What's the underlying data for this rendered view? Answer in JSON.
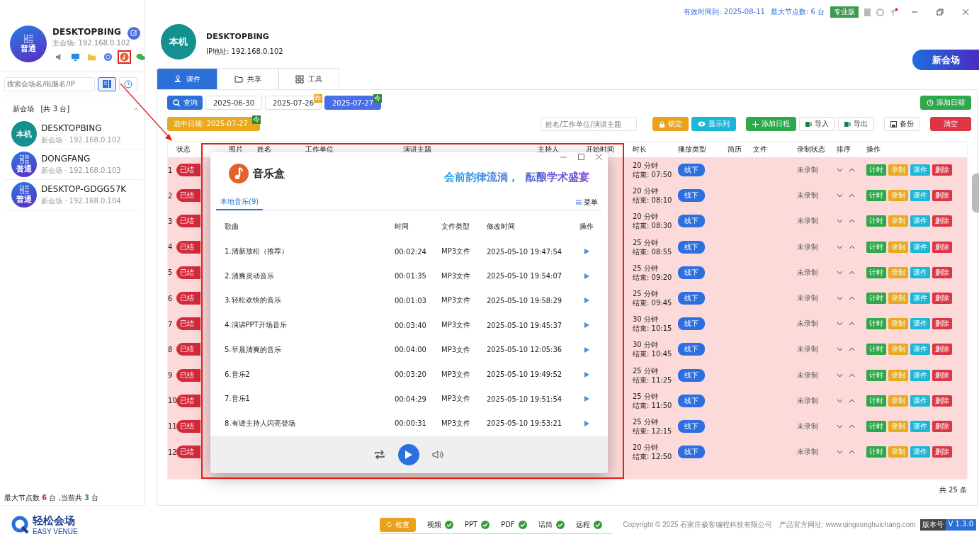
{
  "sidebar": {
    "profile": {
      "avatar_label": "普通",
      "name": "DESKTOPBING",
      "subtitle": "主会场: 192.168.0.102",
      "tools": [
        {
          "kind": "speaker",
          "highlighted": false
        },
        {
          "kind": "monitor",
          "highlighted": false
        },
        {
          "kind": "folder",
          "highlighted": false
        },
        {
          "kind": "globe",
          "highlighted": false
        },
        {
          "kind": "music",
          "highlighted": true
        },
        {
          "kind": "chat",
          "highlighted": false
        }
      ]
    },
    "search": {
      "placeholder": "搜索会场名/电脑名/IP"
    },
    "view_toggles": [
      {
        "kind": "list",
        "selected": true
      },
      {
        "kind": "history",
        "selected": false
      }
    ],
    "group": {
      "title": "新会场",
      "count": "[共 3 台]",
      "expanded": true
    },
    "venues": [
      {
        "kind": "local",
        "avatar_label": "本机",
        "name": "DESKTOPBING",
        "detail": "新会场 · 192.168.0.102"
      },
      {
        "kind": "normal",
        "avatar_label": "普通",
        "name": "DONGFANG",
        "detail": "新会场 · 192.168.0.103"
      },
      {
        "kind": "normal",
        "avatar_label": "普通",
        "name": "DESKTOP-GDGG57K",
        "detail": "新会场 · 192.168.0.104"
      }
    ],
    "footer": {
      "prefix": "最大节点数",
      "max": "6",
      "middle": "台 ,当前共",
      "count": "3",
      "suffix": "台"
    },
    "logo": {
      "name": "轻松会场",
      "tagline": "EASY VENUE"
    }
  },
  "top_bar": {
    "expiry": "有效时间到: 2025-08-11",
    "max_nodes": "最大节点数: 6 台",
    "edition": "专业版",
    "has_update": true
  },
  "header": {
    "avatar_label": "本机",
    "name": "DESKTOPBING",
    "ip": "IP地址: 192.168.0.102",
    "new_button": "新会场"
  },
  "tabs": [
    {
      "kind": "courseware",
      "label": "课件",
      "selected": true
    },
    {
      "kind": "share",
      "label": "共享",
      "selected": false
    },
    {
      "kind": "tools",
      "label": "工具",
      "selected": false
    }
  ],
  "dates": {
    "query": "查询",
    "chips": [
      {
        "date": "2025-06-30",
        "selected": false
      },
      {
        "date": "2025-07-26",
        "badge": "昨",
        "selected": false
      },
      {
        "date": "2025-07-27",
        "badge": "今",
        "selected": true
      }
    ],
    "add_date": "添加日期"
  },
  "toolbar": {
    "selected_date": "选中日期:  2025-07-27",
    "selected_badge": "今",
    "search_placeholder": "姓名/工作单位/演讲主题",
    "buttons": [
      {
        "kind": "lock",
        "label": "锁定"
      },
      {
        "kind": "columns",
        "label": "显示列"
      },
      {
        "kind": "add",
        "label": "添加日程"
      },
      {
        "kind": "import",
        "label": "导入"
      },
      {
        "kind": "export",
        "label": "导出"
      },
      {
        "kind": "backup",
        "label": "备份"
      },
      {
        "kind": "clear",
        "label": "清空"
      }
    ]
  },
  "table": {
    "columns": [
      "状态",
      "照片",
      "姓名",
      "工作单位",
      "演讲主题",
      "主持人",
      "开始时间",
      "时长",
      "播放类型",
      "简历",
      "文件",
      "录制状态",
      "排序",
      "操作"
    ],
    "rows": [
      {
        "index": "1",
        "status": "已结",
        "duration": "20 分钟",
        "end": "结束: 07:50",
        "play_type": "线下",
        "record_status": "未录制",
        "actions": [
          "计时",
          "录制",
          "课件",
          "删除"
        ]
      },
      {
        "index": "2",
        "status": "已结",
        "duration": "20 分钟",
        "end": "结束: 08:10",
        "play_type": "线下",
        "record_status": "未录制",
        "actions": [
          "计时",
          "录制",
          "课件",
          "删除"
        ]
      },
      {
        "index": "3",
        "status": "已结",
        "duration": "20 分钟",
        "end": "结束: 08:30",
        "play_type": "线下",
        "record_status": "未录制",
        "actions": [
          "计时",
          "录制",
          "课件",
          "删除"
        ]
      },
      {
        "index": "4",
        "status": "已结",
        "duration": "25 分钟",
        "end": "结束: 08:55",
        "play_type": "线下",
        "record_status": "未录制",
        "actions": [
          "计时",
          "录制",
          "课件",
          "删除"
        ]
      },
      {
        "index": "5",
        "status": "已结",
        "duration": "25 分钟",
        "end": "结束: 09:20",
        "play_type": "线下",
        "record_status": "未录制",
        "actions": [
          "计时",
          "录制",
          "课件",
          "删除"
        ]
      },
      {
        "index": "6",
        "status": "已结",
        "duration": "25 分钟",
        "end": "结束: 09:45",
        "play_type": "线下",
        "record_status": "未录制",
        "actions": [
          "计时",
          "录制",
          "课件",
          "删除"
        ]
      },
      {
        "index": "7",
        "status": "已结",
        "duration": "30 分钟",
        "end": "结束: 10:15",
        "play_type": "线下",
        "record_status": "未录制",
        "actions": [
          "计时",
          "录制",
          "课件",
          "删除"
        ]
      },
      {
        "index": "8",
        "status": "已结",
        "duration": "30 分钟",
        "end": "结束: 10:45",
        "play_type": "线下",
        "record_status": "未录制",
        "actions": [
          "计时",
          "录制",
          "课件",
          "删除"
        ]
      },
      {
        "index": "9",
        "status": "已结",
        "duration": "25 分钟",
        "end": "结束: 11:25",
        "play_type": "线下",
        "record_status": "未录制",
        "actions": [
          "计时",
          "录制",
          "课件",
          "删除"
        ]
      },
      {
        "index": "10",
        "status": "已结",
        "duration": "25 分钟",
        "end": "结束: 11:50",
        "play_type": "线下",
        "record_status": "未录制",
        "actions": [
          "计时",
          "录制",
          "课件",
          "删除"
        ]
      },
      {
        "index": "11",
        "status": "已结",
        "duration": "25 分钟",
        "end": "结束: 12:15",
        "play_type": "线下",
        "record_status": "未录制",
        "actions": [
          "计时",
          "录制",
          "课件",
          "删除"
        ]
      },
      {
        "index": "12",
        "status": "已结",
        "duration": "20 分钟",
        "end": "结束: 12:50",
        "play_type": "线下",
        "record_status": "未录制",
        "actions": [
          "计时",
          "录制",
          "课件",
          "删除"
        ]
      }
    ],
    "total": "共 25 条"
  },
  "music_dialog": {
    "title": "音乐盒",
    "slogan": "会前韵律流淌，  酝酿学术盛宴",
    "tab": {
      "label": "本地音乐(9)",
      "selected": true
    },
    "menu": "菜单",
    "columns": [
      "歌曲",
      "时间",
      "文件类型",
      "修改时间",
      "操作"
    ],
    "songs": [
      {
        "title": "1.清新放松（推荐）",
        "duration": "00:02:24",
        "type": "MP3文件",
        "modified": "2025-05-10 19:47:54"
      },
      {
        "title": "2.清爽灵动音乐",
        "duration": "00:01:35",
        "type": "MP3文件",
        "modified": "2025-05-10 19:54:07"
      },
      {
        "title": "3.轻松欢快的音乐",
        "duration": "00:01:03",
        "type": "MP3文件",
        "modified": "2025-05-10 19:58:29"
      },
      {
        "title": "4.演讲PPT开场音乐",
        "duration": "00:03:40",
        "type": "MP3文件",
        "modified": "2025-05-10 19:45:37"
      },
      {
        "title": "5.早晨清爽的音乐",
        "duration": "00:04:00",
        "type": "MP3文件",
        "modified": "2025-05-10 12:05:36"
      },
      {
        "title": "6.音乐2",
        "duration": "00:03:20",
        "type": "MP3文件",
        "modified": "2025-05-10 19:49:52"
      },
      {
        "title": "7.音乐1",
        "duration": "00:04:29",
        "type": "MP3文件",
        "modified": "2025-05-10 19:51:54"
      },
      {
        "title": "8.有请主持人闪亮登场",
        "duration": "00:00:31",
        "type": "MP3文件",
        "modified": "2025-05-10 19:53:21"
      }
    ]
  },
  "bottom_bar": {
    "check": "检查",
    "items": [
      {
        "label": "视频",
        "ok": true
      },
      {
        "label": "PPT",
        "ok": true
      },
      {
        "label": "PDF",
        "ok": true
      },
      {
        "label": "话筒",
        "ok": true
      },
      {
        "label": "远程",
        "ok": true
      }
    ],
    "copyright": "Copyright © 2025 石家庄极客编程科技有限公司",
    "website": "产品官方网址: www.qingsonghuichang.com",
    "version_label": "版本号",
    "version": "V 1.3.0"
  }
}
